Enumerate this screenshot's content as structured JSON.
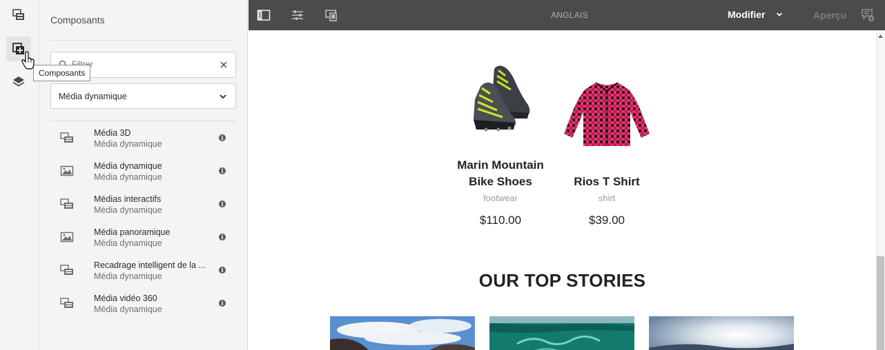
{
  "rail": {
    "items": [
      {
        "name": "assets-icon"
      },
      {
        "name": "components-icon"
      },
      {
        "name": "layers-icon"
      }
    ],
    "tooltip": "Composants"
  },
  "panel": {
    "title": "Composants",
    "search": {
      "placeholder": "Filtrer",
      "value": ""
    },
    "group_select": "Média dynamique",
    "items": [
      {
        "name": "Média 3D",
        "group": "Média dynamique",
        "icon": "media-icon"
      },
      {
        "name": "Média dynamique",
        "group": "Média dynamique",
        "icon": "image-icon"
      },
      {
        "name": "Médias interactifs",
        "group": "Média dynamique",
        "icon": "media-icon"
      },
      {
        "name": "Média panoramique",
        "group": "Média dynamique",
        "icon": "image-icon"
      },
      {
        "name": "Recadrage intelligent de la ...",
        "group": "Média dynamique",
        "icon": "media-icon"
      },
      {
        "name": "Média vidéo 360",
        "group": "Média dynamique",
        "icon": "media-icon"
      }
    ]
  },
  "toolbar": {
    "language": "ANGLAIS",
    "mode": "Modifier",
    "preview": "Aperçu"
  },
  "content": {
    "products": [
      {
        "name": "Marin Mountain Bike Shoes",
        "category": "footwear",
        "price": "$110.00"
      },
      {
        "name": "Rios T Shirt",
        "category": "shirt",
        "price": "$39.00"
      }
    ],
    "stories_title": "OUR TOP STORIES"
  },
  "colors": {
    "toolbar_bg": "#4b4b4b",
    "panel_bg": "#f4f4f4",
    "shirt_pink": "#e8336b"
  }
}
